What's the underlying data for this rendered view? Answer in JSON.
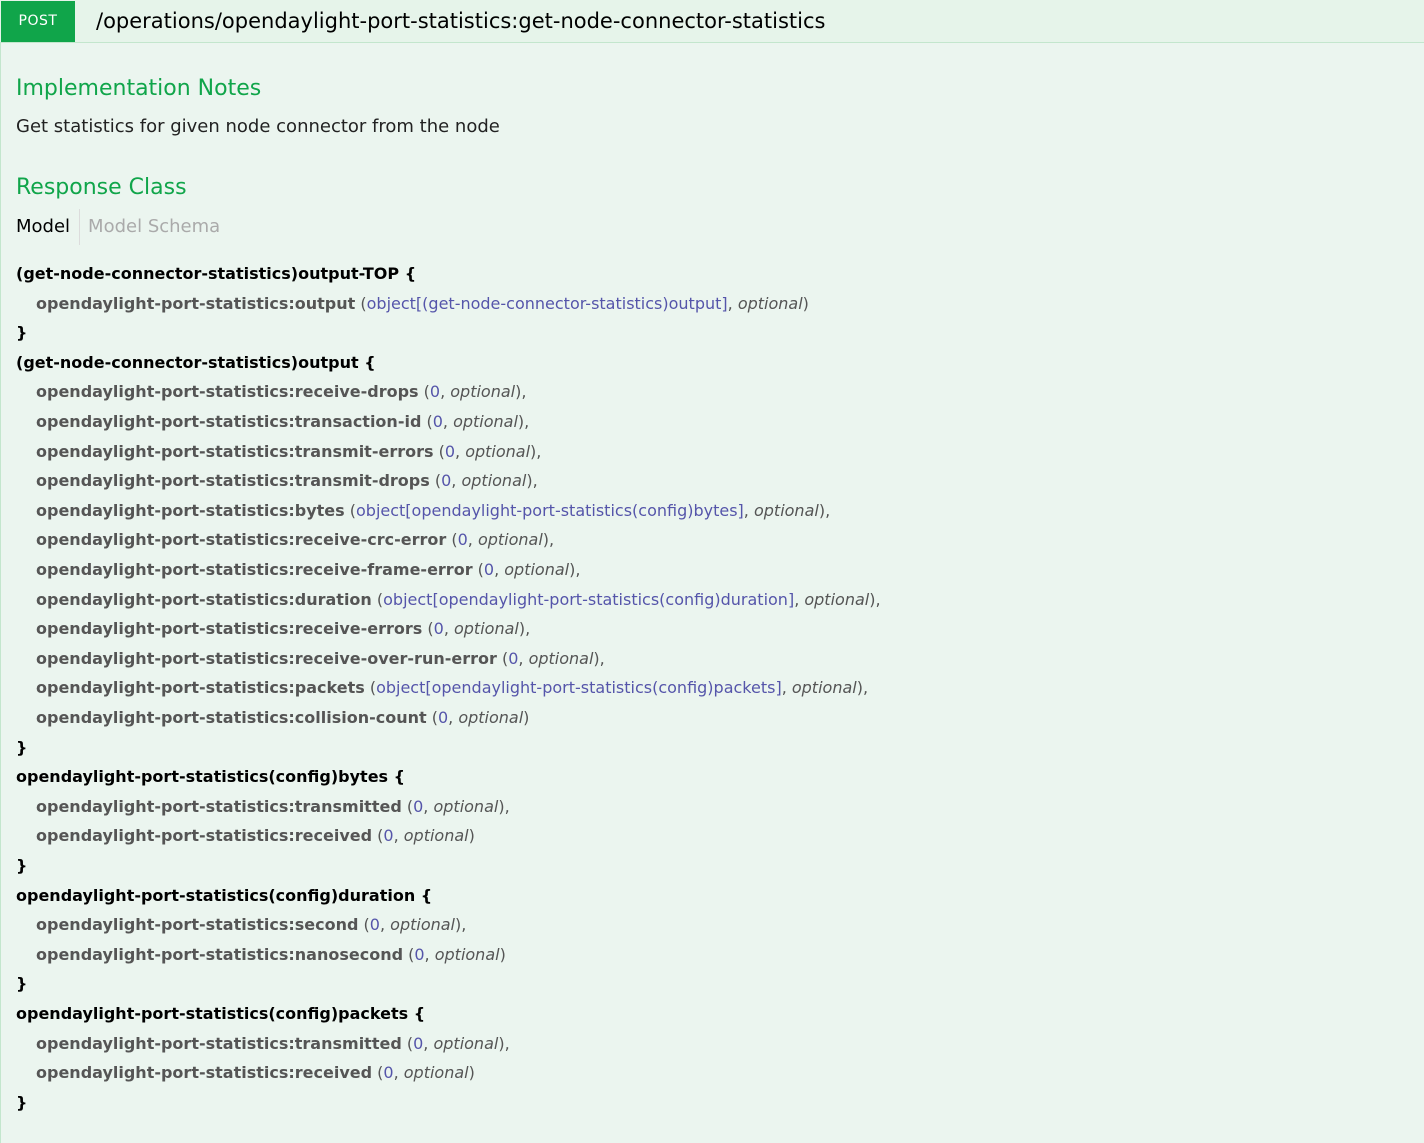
{
  "operation": {
    "method": "POST",
    "path": "/operations/opendaylight-port-statistics:get-node-connector-statistics"
  },
  "implementation_notes": {
    "title": "Implementation Notes",
    "text": "Get statistics for given node connector from the node"
  },
  "response_class": {
    "title": "Response Class",
    "tabs": [
      "Model",
      "Model Schema"
    ],
    "active_tab": "Model"
  },
  "model": [
    {
      "name": "(get-node-connector-statistics)output-TOP",
      "open": "{",
      "close": "}",
      "props": [
        {
          "name": "opendaylight-port-statistics:output",
          "type": "object[(get-node-connector-statistics)output]",
          "opt": "optional",
          "sep": ""
        }
      ]
    },
    {
      "name": "(get-node-connector-statistics)output",
      "open": "{",
      "close": "}",
      "props": [
        {
          "name": "opendaylight-port-statistics:receive-drops",
          "type": "0",
          "opt": "optional",
          "sep": ","
        },
        {
          "name": "opendaylight-port-statistics:transaction-id",
          "type": "0",
          "opt": "optional",
          "sep": ","
        },
        {
          "name": "opendaylight-port-statistics:transmit-errors",
          "type": "0",
          "opt": "optional",
          "sep": ","
        },
        {
          "name": "opendaylight-port-statistics:transmit-drops",
          "type": "0",
          "opt": "optional",
          "sep": ","
        },
        {
          "name": "opendaylight-port-statistics:bytes",
          "type": "object[opendaylight-port-statistics(config)bytes]",
          "opt": "optional",
          "sep": ","
        },
        {
          "name": "opendaylight-port-statistics:receive-crc-error",
          "type": "0",
          "opt": "optional",
          "sep": ","
        },
        {
          "name": "opendaylight-port-statistics:receive-frame-error",
          "type": "0",
          "opt": "optional",
          "sep": ","
        },
        {
          "name": "opendaylight-port-statistics:duration",
          "type": "object[opendaylight-port-statistics(config)duration]",
          "opt": "optional",
          "sep": ","
        },
        {
          "name": "opendaylight-port-statistics:receive-errors",
          "type": "0",
          "opt": "optional",
          "sep": ","
        },
        {
          "name": "opendaylight-port-statistics:receive-over-run-error",
          "type": "0",
          "opt": "optional",
          "sep": ","
        },
        {
          "name": "opendaylight-port-statistics:packets",
          "type": "object[opendaylight-port-statistics(config)packets]",
          "opt": "optional",
          "sep": ","
        },
        {
          "name": "opendaylight-port-statistics:collision-count",
          "type": "0",
          "opt": "optional",
          "sep": ""
        }
      ]
    },
    {
      "name": "opendaylight-port-statistics(config)bytes",
      "open": "{",
      "close": "}",
      "props": [
        {
          "name": "opendaylight-port-statistics:transmitted",
          "type": "0",
          "opt": "optional",
          "sep": ","
        },
        {
          "name": "opendaylight-port-statistics:received",
          "type": "0",
          "opt": "optional",
          "sep": ""
        }
      ]
    },
    {
      "name": "opendaylight-port-statistics(config)duration",
      "open": "{",
      "close": "}",
      "props": [
        {
          "name": "opendaylight-port-statistics:second",
          "type": "0",
          "opt": "optional",
          "sep": ","
        },
        {
          "name": "opendaylight-port-statistics:nanosecond",
          "type": "0",
          "opt": "optional",
          "sep": ""
        }
      ]
    },
    {
      "name": "opendaylight-port-statistics(config)packets",
      "open": "{",
      "close": "}",
      "props": [
        {
          "name": "opendaylight-port-statistics:transmitted",
          "type": "0",
          "opt": "optional",
          "sep": ","
        },
        {
          "name": "opendaylight-port-statistics:received",
          "type": "0",
          "opt": "optional",
          "sep": ""
        }
      ]
    }
  ]
}
